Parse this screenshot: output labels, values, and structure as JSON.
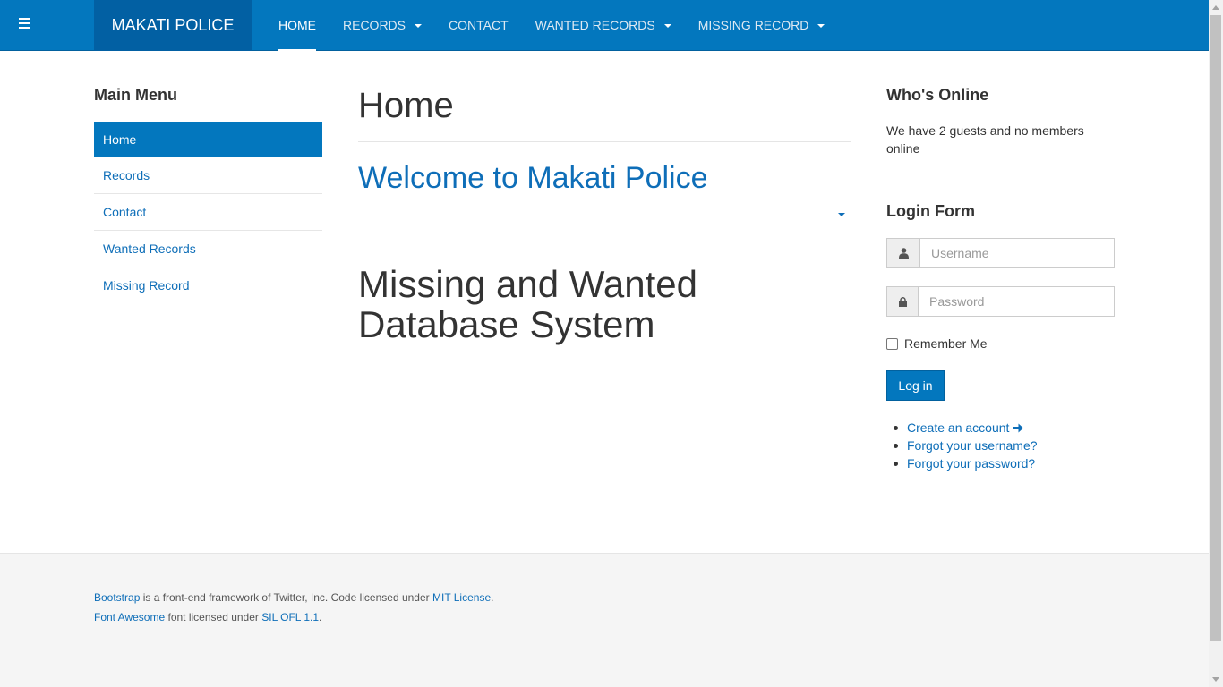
{
  "navbar": {
    "brand": "MAKATI POLICE",
    "items": [
      {
        "label": "HOME",
        "active": true,
        "dropdown": false
      },
      {
        "label": "RECORDS",
        "active": false,
        "dropdown": true
      },
      {
        "label": "CONTACT",
        "active": false,
        "dropdown": false
      },
      {
        "label": "WANTED RECORDS",
        "active": false,
        "dropdown": true
      },
      {
        "label": "MISSING RECORD",
        "active": false,
        "dropdown": true
      }
    ],
    "menu_icon": "hamburger-icon",
    "color": "#0377be"
  },
  "sidebar": {
    "heading": "Main Menu",
    "items": [
      {
        "label": "Home",
        "active": true
      },
      {
        "label": "Records",
        "active": false
      },
      {
        "label": "Contact",
        "active": false
      },
      {
        "label": "Wanted Records",
        "active": false
      },
      {
        "label": "Missing Record",
        "active": false
      }
    ]
  },
  "main": {
    "title": "Home",
    "welcome": "Welcome to Makati Police",
    "headline": "Missing and Wanted Database System"
  },
  "right": {
    "online_heading": "Who's Online",
    "online_text": "We have 2 guests and no members online",
    "login_heading": "Login Form",
    "username_placeholder": "Username",
    "password_placeholder": "Password",
    "remember_label": "Remember Me",
    "login_button": "Log in",
    "links": [
      {
        "label": "Create an account",
        "icon": "arrow-right-icon"
      },
      {
        "label": "Forgot your username?"
      },
      {
        "label": "Forgot your password?"
      }
    ]
  },
  "footer": {
    "line1": {
      "link1": "Bootstrap",
      "text1": " is a front-end framework of Twitter, Inc. Code licensed under ",
      "link2": "MIT License",
      "text2": "."
    },
    "line2": {
      "link1": "Font Awesome",
      "text1": " font licensed under ",
      "link2": "SIL OFL 1.1",
      "text2": "."
    }
  }
}
